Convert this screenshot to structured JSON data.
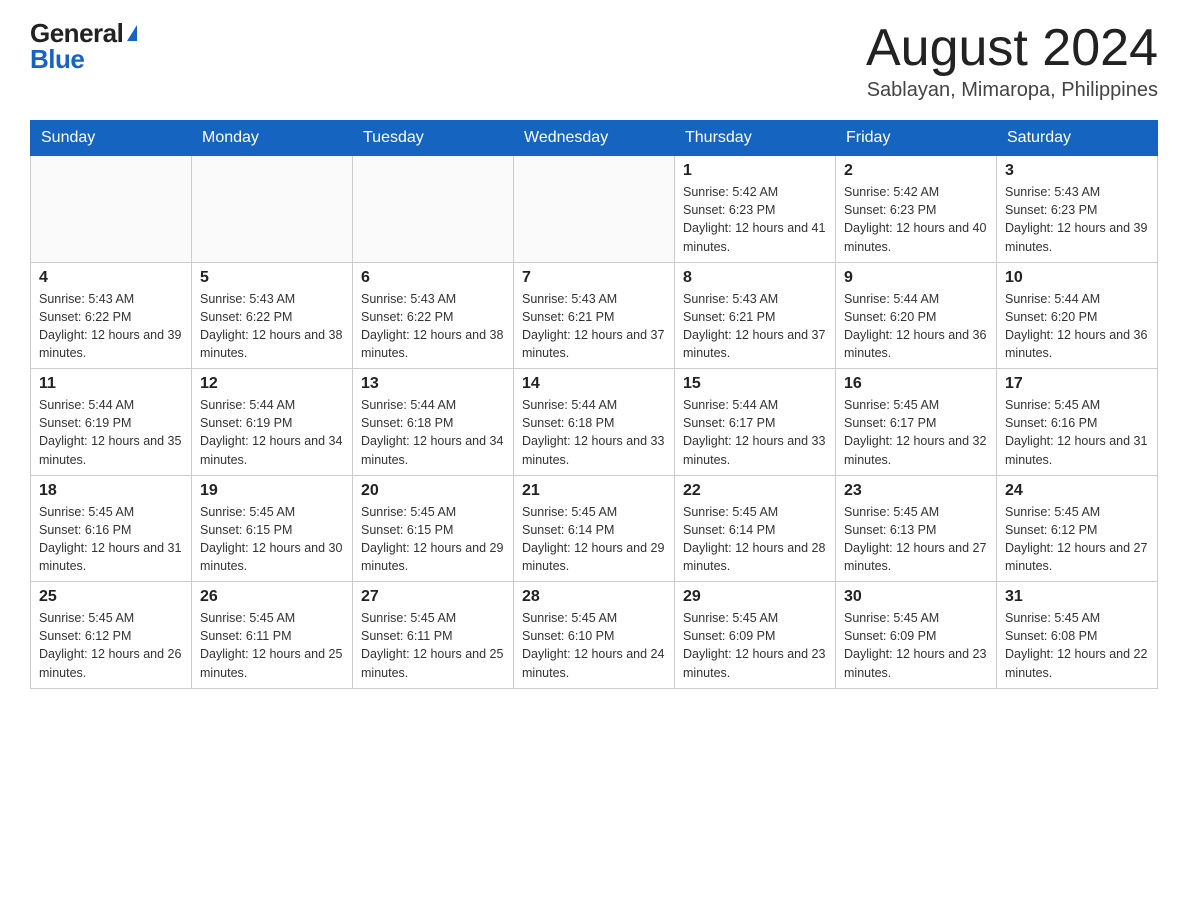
{
  "header": {
    "logo_general": "General",
    "logo_blue": "Blue",
    "month_year": "August 2024",
    "location": "Sablayan, Mimaropa, Philippines"
  },
  "weekdays": [
    "Sunday",
    "Monday",
    "Tuesday",
    "Wednesday",
    "Thursday",
    "Friday",
    "Saturday"
  ],
  "weeks": [
    [
      {
        "day": "",
        "info": ""
      },
      {
        "day": "",
        "info": ""
      },
      {
        "day": "",
        "info": ""
      },
      {
        "day": "",
        "info": ""
      },
      {
        "day": "1",
        "info": "Sunrise: 5:42 AM\nSunset: 6:23 PM\nDaylight: 12 hours and 41 minutes."
      },
      {
        "day": "2",
        "info": "Sunrise: 5:42 AM\nSunset: 6:23 PM\nDaylight: 12 hours and 40 minutes."
      },
      {
        "day": "3",
        "info": "Sunrise: 5:43 AM\nSunset: 6:23 PM\nDaylight: 12 hours and 39 minutes."
      }
    ],
    [
      {
        "day": "4",
        "info": "Sunrise: 5:43 AM\nSunset: 6:22 PM\nDaylight: 12 hours and 39 minutes."
      },
      {
        "day": "5",
        "info": "Sunrise: 5:43 AM\nSunset: 6:22 PM\nDaylight: 12 hours and 38 minutes."
      },
      {
        "day": "6",
        "info": "Sunrise: 5:43 AM\nSunset: 6:22 PM\nDaylight: 12 hours and 38 minutes."
      },
      {
        "day": "7",
        "info": "Sunrise: 5:43 AM\nSunset: 6:21 PM\nDaylight: 12 hours and 37 minutes."
      },
      {
        "day": "8",
        "info": "Sunrise: 5:43 AM\nSunset: 6:21 PM\nDaylight: 12 hours and 37 minutes."
      },
      {
        "day": "9",
        "info": "Sunrise: 5:44 AM\nSunset: 6:20 PM\nDaylight: 12 hours and 36 minutes."
      },
      {
        "day": "10",
        "info": "Sunrise: 5:44 AM\nSunset: 6:20 PM\nDaylight: 12 hours and 36 minutes."
      }
    ],
    [
      {
        "day": "11",
        "info": "Sunrise: 5:44 AM\nSunset: 6:19 PM\nDaylight: 12 hours and 35 minutes."
      },
      {
        "day": "12",
        "info": "Sunrise: 5:44 AM\nSunset: 6:19 PM\nDaylight: 12 hours and 34 minutes."
      },
      {
        "day": "13",
        "info": "Sunrise: 5:44 AM\nSunset: 6:18 PM\nDaylight: 12 hours and 34 minutes."
      },
      {
        "day": "14",
        "info": "Sunrise: 5:44 AM\nSunset: 6:18 PM\nDaylight: 12 hours and 33 minutes."
      },
      {
        "day": "15",
        "info": "Sunrise: 5:44 AM\nSunset: 6:17 PM\nDaylight: 12 hours and 33 minutes."
      },
      {
        "day": "16",
        "info": "Sunrise: 5:45 AM\nSunset: 6:17 PM\nDaylight: 12 hours and 32 minutes."
      },
      {
        "day": "17",
        "info": "Sunrise: 5:45 AM\nSunset: 6:16 PM\nDaylight: 12 hours and 31 minutes."
      }
    ],
    [
      {
        "day": "18",
        "info": "Sunrise: 5:45 AM\nSunset: 6:16 PM\nDaylight: 12 hours and 31 minutes."
      },
      {
        "day": "19",
        "info": "Sunrise: 5:45 AM\nSunset: 6:15 PM\nDaylight: 12 hours and 30 minutes."
      },
      {
        "day": "20",
        "info": "Sunrise: 5:45 AM\nSunset: 6:15 PM\nDaylight: 12 hours and 29 minutes."
      },
      {
        "day": "21",
        "info": "Sunrise: 5:45 AM\nSunset: 6:14 PM\nDaylight: 12 hours and 29 minutes."
      },
      {
        "day": "22",
        "info": "Sunrise: 5:45 AM\nSunset: 6:14 PM\nDaylight: 12 hours and 28 minutes."
      },
      {
        "day": "23",
        "info": "Sunrise: 5:45 AM\nSunset: 6:13 PM\nDaylight: 12 hours and 27 minutes."
      },
      {
        "day": "24",
        "info": "Sunrise: 5:45 AM\nSunset: 6:12 PM\nDaylight: 12 hours and 27 minutes."
      }
    ],
    [
      {
        "day": "25",
        "info": "Sunrise: 5:45 AM\nSunset: 6:12 PM\nDaylight: 12 hours and 26 minutes."
      },
      {
        "day": "26",
        "info": "Sunrise: 5:45 AM\nSunset: 6:11 PM\nDaylight: 12 hours and 25 minutes."
      },
      {
        "day": "27",
        "info": "Sunrise: 5:45 AM\nSunset: 6:11 PM\nDaylight: 12 hours and 25 minutes."
      },
      {
        "day": "28",
        "info": "Sunrise: 5:45 AM\nSunset: 6:10 PM\nDaylight: 12 hours and 24 minutes."
      },
      {
        "day": "29",
        "info": "Sunrise: 5:45 AM\nSunset: 6:09 PM\nDaylight: 12 hours and 23 minutes."
      },
      {
        "day": "30",
        "info": "Sunrise: 5:45 AM\nSunset: 6:09 PM\nDaylight: 12 hours and 23 minutes."
      },
      {
        "day": "31",
        "info": "Sunrise: 5:45 AM\nSunset: 6:08 PM\nDaylight: 12 hours and 22 minutes."
      }
    ]
  ]
}
